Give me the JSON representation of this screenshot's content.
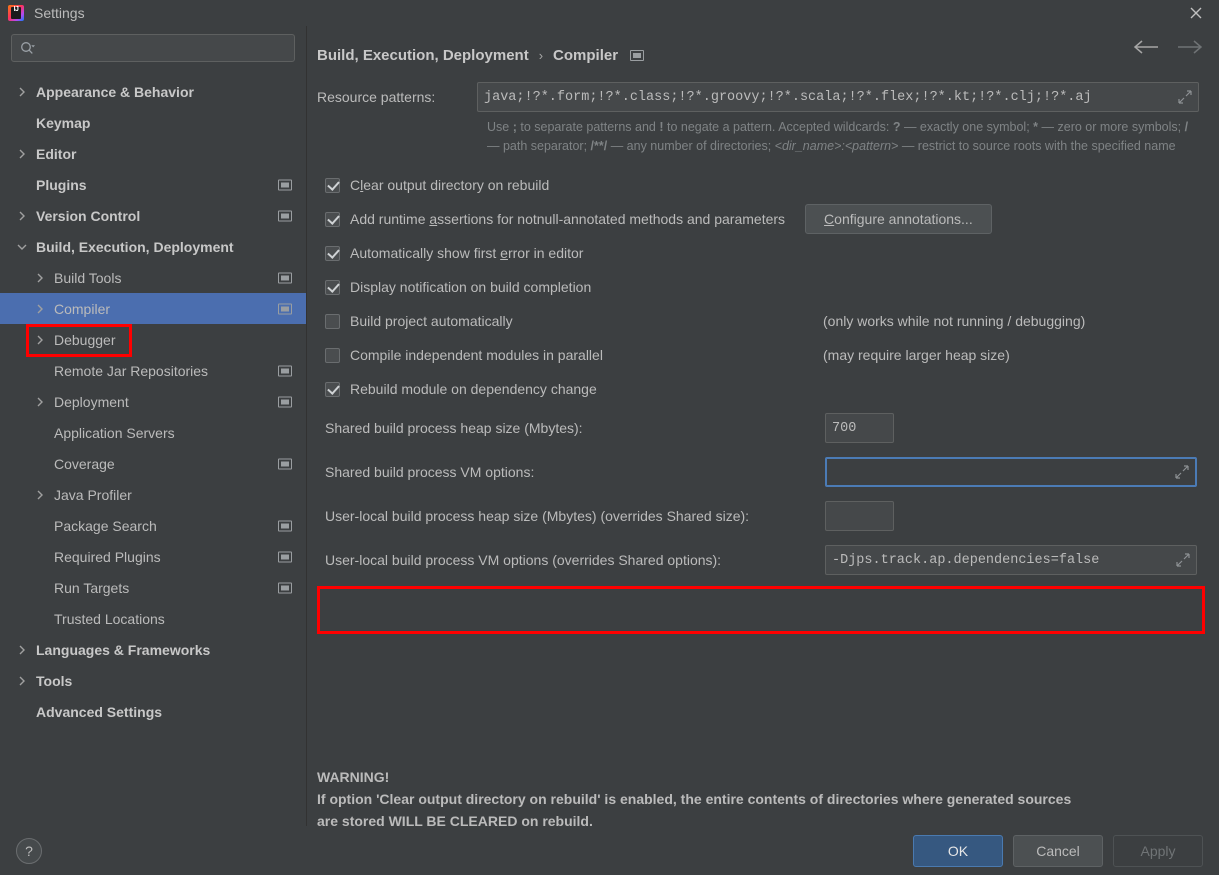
{
  "window": {
    "title": "Settings",
    "logo_text": "IJ",
    "close_icon": "close-icon"
  },
  "search": {
    "value": "",
    "placeholder": ""
  },
  "sidebar": {
    "items": [
      {
        "label": "Appearance & Behavior",
        "arrow": "collapsed",
        "bold": true,
        "indent": 0,
        "scope": false,
        "selected": false
      },
      {
        "label": "Keymap",
        "arrow": "none",
        "bold": true,
        "indent": 0,
        "scope": false,
        "selected": false
      },
      {
        "label": "Editor",
        "arrow": "collapsed",
        "bold": true,
        "indent": 0,
        "scope": false,
        "selected": false
      },
      {
        "label": "Plugins",
        "arrow": "none",
        "bold": true,
        "indent": 0,
        "scope": true,
        "selected": false
      },
      {
        "label": "Version Control",
        "arrow": "collapsed",
        "bold": true,
        "indent": 0,
        "scope": true,
        "selected": false
      },
      {
        "label": "Build, Execution, Deployment",
        "arrow": "expanded",
        "bold": true,
        "indent": 0,
        "scope": false,
        "selected": false
      },
      {
        "label": "Build Tools",
        "arrow": "collapsed",
        "bold": false,
        "indent": 1,
        "scope": true,
        "selected": false
      },
      {
        "label": "Compiler",
        "arrow": "collapsed",
        "bold": false,
        "indent": 1,
        "scope": true,
        "selected": true
      },
      {
        "label": "Debugger",
        "arrow": "collapsed",
        "bold": false,
        "indent": 1,
        "scope": false,
        "selected": false
      },
      {
        "label": "Remote Jar Repositories",
        "arrow": "none",
        "bold": false,
        "indent": 1,
        "scope": true,
        "selected": false
      },
      {
        "label": "Deployment",
        "arrow": "collapsed",
        "bold": false,
        "indent": 1,
        "scope": true,
        "selected": false
      },
      {
        "label": "Application Servers",
        "arrow": "none",
        "bold": false,
        "indent": 1,
        "scope": false,
        "selected": false
      },
      {
        "label": "Coverage",
        "arrow": "none",
        "bold": false,
        "indent": 1,
        "scope": true,
        "selected": false
      },
      {
        "label": "Java Profiler",
        "arrow": "collapsed",
        "bold": false,
        "indent": 1,
        "scope": false,
        "selected": false
      },
      {
        "label": "Package Search",
        "arrow": "none",
        "bold": false,
        "indent": 1,
        "scope": true,
        "selected": false
      },
      {
        "label": "Required Plugins",
        "arrow": "none",
        "bold": false,
        "indent": 1,
        "scope": true,
        "selected": false
      },
      {
        "label": "Run Targets",
        "arrow": "none",
        "bold": false,
        "indent": 1,
        "scope": true,
        "selected": false
      },
      {
        "label": "Trusted Locations",
        "arrow": "none",
        "bold": false,
        "indent": 1,
        "scope": false,
        "selected": false
      },
      {
        "label": "Languages & Frameworks",
        "arrow": "collapsed",
        "bold": true,
        "indent": 0,
        "scope": false,
        "selected": false
      },
      {
        "label": "Tools",
        "arrow": "collapsed",
        "bold": true,
        "indent": 0,
        "scope": false,
        "selected": false
      },
      {
        "label": "Advanced Settings",
        "arrow": "none",
        "bold": true,
        "indent": 0,
        "scope": false,
        "selected": false
      }
    ]
  },
  "breadcrumb": {
    "root": "Build, Execution, Deployment",
    "separator": "›",
    "current": "Compiler"
  },
  "main": {
    "resource_patterns": {
      "label": "Resource patterns:",
      "value": "java;!?*.form;!?*.class;!?*.groovy;!?*.scala;!?*.flex;!?*.kt;!?*.clj;!?*.aj"
    },
    "hint_line1_a": "Use ",
    "hint_semicolon": ";",
    "hint_line1_b": " to separate patterns and ",
    "hint_bang": "!",
    "hint_line1_c": " to negate a pattern. Accepted wildcards: ",
    "hint_q": "?",
    "hint_line1_d": " — exactly one symbol; ",
    "hint_star": "*",
    "hint_line1_e": " — zero or more symbols; ",
    "hint_slash": "/",
    "hint_line2_a": " — path separator; ",
    "hint_globstar": "/**/",
    "hint_line2_b": " — any number of directories; ",
    "hint_dirname": "<dir_name>:<pattern>",
    "hint_line2_c": " — restrict to source roots with the specified name",
    "checkboxes": [
      {
        "label_pre": "C",
        "label_mn": "l",
        "label_post": "ear output directory on rebuild",
        "full": "Clear output directory on rebuild",
        "checked": true,
        "note": ""
      },
      {
        "label_pre": "Add runtime ",
        "label_mn": "a",
        "label_post": "ssertions for notnull-annotated methods and parameters",
        "full": "Add runtime assertions for notnull-annotated methods and parameters",
        "checked": true,
        "note": ""
      },
      {
        "label_pre": "Automatically show first ",
        "label_mn": "e",
        "label_post": "rror in editor",
        "full": "Automatically show first error in editor",
        "checked": true,
        "note": ""
      },
      {
        "label_pre": "Display notification on build completion",
        "label_mn": "",
        "label_post": "",
        "full": "Display notification on build completion",
        "checked": true,
        "note": ""
      },
      {
        "label_pre": "Build project automatically",
        "label_mn": "",
        "label_post": "",
        "full": "Build project automatically",
        "checked": false,
        "note": "(only works while not running / debugging)"
      },
      {
        "label_pre": "Compile independent modules in parallel",
        "label_mn": "",
        "label_post": "",
        "full": "Compile independent modules in parallel",
        "checked": false,
        "note": "(may require larger heap size)"
      },
      {
        "label_pre": "Rebuild module on dependency change",
        "label_mn": "",
        "label_post": "",
        "full": "Rebuild module on dependency change",
        "checked": true,
        "note": ""
      }
    ],
    "configure_annotations_button": {
      "mnemonic": "C",
      "rest": "onfigure annotations..."
    },
    "shared_heap": {
      "label": "Shared build process heap size (Mbytes):",
      "value": "700"
    },
    "shared_vm": {
      "label": "Shared build process VM options:",
      "value": ""
    },
    "local_heap": {
      "label": "User-local build process heap size (Mbytes) (overrides Shared size):",
      "value": ""
    },
    "local_vm": {
      "label": "User-local build process VM options (overrides Shared options):",
      "value": "-Djps.track.ap.dependencies=false"
    },
    "warning": {
      "title": "WARNING!",
      "line1": "If option 'Clear output directory on rebuild' is enabled, the entire contents of directories where generated sources",
      "line2": "are stored WILL BE CLEARED on rebuild."
    }
  },
  "footer": {
    "help_label": "?",
    "ok_label": "OK",
    "cancel_label": "Cancel",
    "apply_label": "Apply"
  },
  "colors": {
    "window_bg": "#3c3f41",
    "selection_blue": "#4b6eaf",
    "primary_button": "#365880",
    "annotation_red": "#ff0000",
    "focus_border": "#4b7bb5"
  }
}
